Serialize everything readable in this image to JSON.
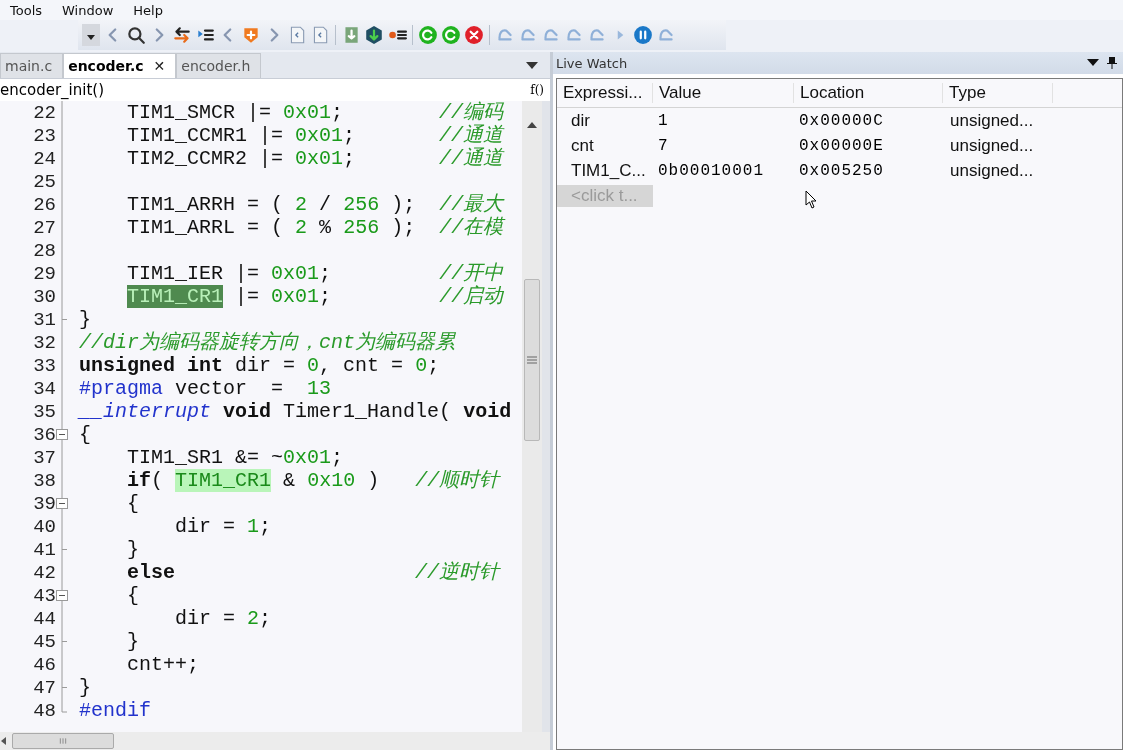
{
  "menu": [
    "Tools",
    "Window",
    "Help"
  ],
  "tabs": [
    {
      "label": "main.c",
      "selected": false,
      "closable": false
    },
    {
      "label": "encoder.c",
      "selected": true,
      "closable": true
    },
    {
      "label": "encoder.h",
      "selected": false,
      "closable": false
    }
  ],
  "tab_close": "✕",
  "function_bar": {
    "name": "encoder_init()",
    "icon": "f()"
  },
  "code": [
    {
      "num": "22",
      "kind": "line",
      "tokens": [
        {
          "kind": "text",
          "s": "    TIM1_SMCR |="
        },
        {
          "kind": "number",
          "s": " 0x01"
        },
        {
          "kind": "text",
          "s": ";"
        },
        {
          "kind": "comment",
          "s": "        //编码"
        }
      ]
    },
    {
      "num": "23",
      "kind": "line",
      "tokens": [
        {
          "kind": "text",
          "s": "    TIM1_CCMR1 |="
        },
        {
          "kind": "number",
          "s": " 0x01"
        },
        {
          "kind": "text",
          "s": ";"
        },
        {
          "kind": "comment",
          "s": "       //通道"
        }
      ]
    },
    {
      "num": "24",
      "kind": "line",
      "tokens": [
        {
          "kind": "text",
          "s": "    TIM2_CCMR2 |="
        },
        {
          "kind": "number",
          "s": " 0x01"
        },
        {
          "kind": "text",
          "s": ";"
        },
        {
          "kind": "comment",
          "s": "       //通道"
        }
      ]
    },
    {
      "num": "25",
      "kind": "line"
    },
    {
      "num": "26",
      "kind": "line",
      "tokens": [
        {
          "kind": "text",
          "s": "    TIM1_ARRH = ("
        },
        {
          "kind": "number",
          "s": " 2"
        },
        {
          "kind": "text",
          "s": " /"
        },
        {
          "kind": "number",
          "s": " 256"
        },
        {
          "kind": "text",
          "s": " );"
        },
        {
          "kind": "comment",
          "s": "  //最大"
        }
      ]
    },
    {
      "num": "27",
      "kind": "line",
      "tokens": [
        {
          "kind": "text",
          "s": "    TIM1_ARRL = ("
        },
        {
          "kind": "number",
          "s": " 2"
        },
        {
          "kind": "text",
          "s": " %"
        },
        {
          "kind": "number",
          "s": " 256"
        },
        {
          "kind": "text",
          "s": " );"
        },
        {
          "kind": "comment",
          "s": "  //在模"
        }
      ]
    },
    {
      "num": "28",
      "kind": "line"
    },
    {
      "num": "29",
      "kind": "line",
      "tokens": [
        {
          "kind": "text",
          "s": "    TIM1_IER |="
        },
        {
          "kind": "number",
          "s": " 0x01"
        },
        {
          "kind": "text",
          "s": ";"
        },
        {
          "kind": "comment",
          "s": "         //开中"
        }
      ]
    },
    {
      "num": "30",
      "kind": "line",
      "tokens": [
        {
          "kind": "highlight",
          "s": "    TIM1_CR1"
        },
        {
          "kind": "text",
          "s": " |="
        },
        {
          "kind": "number",
          "s": " 0x01"
        },
        {
          "kind": "text",
          "s": ";"
        },
        {
          "kind": "comment",
          "s": "         //启动"
        }
      ]
    },
    {
      "num": "31",
      "kind": "end",
      "tokens": [
        {
          "kind": "text",
          "s": "}"
        }
      ]
    },
    {
      "num": "32",
      "kind": "line",
      "tokens": [
        {
          "kind": "comment",
          "s": "//dir为编码器旋转方向，cnt为编码器累"
        }
      ]
    },
    {
      "num": "33",
      "kind": "line",
      "tokens": [
        {
          "kind": "keyword",
          "s": "unsigned int"
        },
        {
          "kind": "text",
          "s": " dir ="
        },
        {
          "kind": "number",
          "s": " 0"
        },
        {
          "kind": "text",
          "s": ", cnt ="
        },
        {
          "kind": "number",
          "s": " 0"
        },
        {
          "kind": "text",
          "s": ";"
        }
      ]
    },
    {
      "num": "34",
      "kind": "line",
      "tokens": [
        {
          "kind": "preprocessor",
          "s": "#pragma"
        },
        {
          "kind": "text",
          "s": " vector  ="
        },
        {
          "kind": "number",
          "s": "  13"
        }
      ]
    },
    {
      "num": "35",
      "kind": "line",
      "tokens": [
        {
          "kind": "modifier",
          "s": "__interrupt"
        },
        {
          "kind": "keyword",
          "s": " void"
        },
        {
          "kind": "text",
          "s": " Timer1_Handle("
        },
        {
          "kind": "keyword",
          "s": " void"
        }
      ]
    },
    {
      "num": "36",
      "kind": "start",
      "tokens": [
        {
          "kind": "text",
          "s": "{"
        }
      ]
    },
    {
      "num": "37",
      "kind": "line",
      "tokens": [
        {
          "kind": "text",
          "s": "    TIM1_SR1 &= ~"
        },
        {
          "kind": "number",
          "s": "0x01"
        },
        {
          "kind": "text",
          "s": ";"
        }
      ]
    },
    {
      "num": "38",
      "kind": "line",
      "tokens": [
        {
          "kind": "keyword",
          "s": "    if"
        },
        {
          "kind": "text",
          "s": "("
        },
        {
          "kind": "reference",
          "s": " TIM1_CR1"
        },
        {
          "kind": "text",
          "s": " &"
        },
        {
          "kind": "number",
          "s": " 0x10"
        },
        {
          "kind": "text",
          "s": " )"
        },
        {
          "kind": "comment",
          "s": "   //顺时针"
        }
      ]
    },
    {
      "num": "39",
      "kind": "start",
      "tokens": [
        {
          "kind": "text",
          "s": "    {"
        }
      ]
    },
    {
      "num": "40",
      "kind": "line",
      "tokens": [
        {
          "kind": "text",
          "s": "        dir ="
        },
        {
          "kind": "number",
          "s": " 1"
        },
        {
          "kind": "text",
          "s": ";"
        }
      ]
    },
    {
      "num": "41",
      "kind": "end",
      "tokens": [
        {
          "kind": "text",
          "s": "    }"
        }
      ]
    },
    {
      "num": "42",
      "kind": "line",
      "tokens": [
        {
          "kind": "keyword",
          "s": "    else"
        },
        {
          "kind": "comment",
          "s": "                    //逆时针"
        }
      ]
    },
    {
      "num": "43",
      "kind": "start",
      "tokens": [
        {
          "kind": "text",
          "s": "    {"
        }
      ]
    },
    {
      "num": "44",
      "kind": "line",
      "tokens": [
        {
          "kind": "text",
          "s": "        dir ="
        },
        {
          "kind": "number",
          "s": " 2"
        },
        {
          "kind": "text",
          "s": ";"
        }
      ]
    },
    {
      "num": "45",
      "kind": "end",
      "tokens": [
        {
          "kind": "text",
          "s": "    }"
        }
      ]
    },
    {
      "num": "46",
      "kind": "line",
      "tokens": [
        {
          "kind": "text",
          "s": "    cnt++;"
        }
      ]
    },
    {
      "num": "47",
      "kind": "end",
      "tokens": [
        {
          "kind": "text",
          "s": "}"
        }
      ]
    },
    {
      "num": "48",
      "kind": "last",
      "tokens": [
        {
          "kind": "preprocessor",
          "s": "#endif"
        }
      ]
    }
  ],
  "live_watch": {
    "title": "Live Watch",
    "columns": [
      "Expressi...",
      "Value",
      "Location",
      "Type"
    ],
    "rows": [
      {
        "expression": "dir",
        "value": "1",
        "location": "0x00000C",
        "type": "unsigned..."
      },
      {
        "expression": "cnt",
        "value": "7",
        "location": "0x00000E",
        "type": "unsigned..."
      },
      {
        "expression": "TIM1_C...",
        "value": "0b00010001",
        "location": "0x005250",
        "type": "unsigned..."
      }
    ],
    "placeholder": "<click t..."
  }
}
